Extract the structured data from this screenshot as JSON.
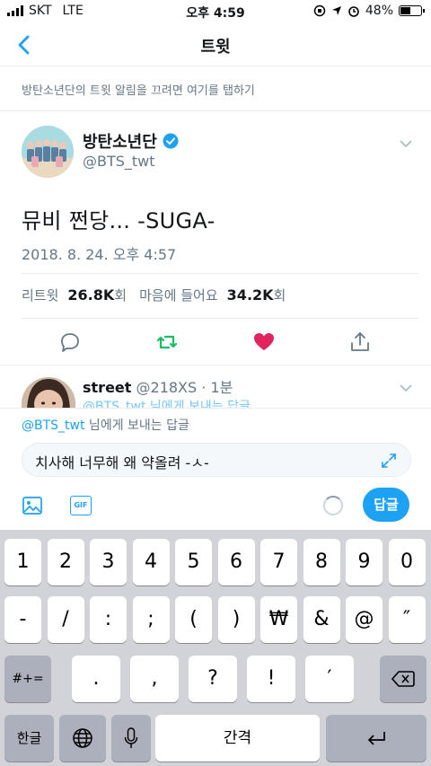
{
  "status": {
    "carrier": "SKT",
    "network": "LTE",
    "time": "오후 4:59",
    "battery": "48%",
    "battery_level": 0.48
  },
  "nav": {
    "title": "트윗"
  },
  "notice": {
    "text": "방탄소년단의 트윗 알림을 끄려면 여기를 탭하기"
  },
  "tweet": {
    "name": "방탄소년단",
    "handle": "@BTS_twt",
    "text": "뮤비 쩐당... -SUGA-",
    "date": "2018. 8. 24. 오후 4:57",
    "retweet_label": "리트윗",
    "retweet_count": "26.8K",
    "retweet_unit": "회",
    "likes_label": "마음에 들어요",
    "likes_count": "34.2K",
    "likes_unit": "회"
  },
  "reply": {
    "name": "street",
    "meta": "@218XS · 1분",
    "to_ghost": "@BTS_twt 님에게 보내는 답글"
  },
  "compose": {
    "reply_to_mention": "@BTS_twt",
    "reply_to_text": " 님에게 보내는 답글",
    "input_value": "치사해 너무해 왜 약올려 -ㅅ-",
    "gif_label": "GIF",
    "send_label": "답글"
  },
  "colors": {
    "accent": "#1da1f2",
    "retweet": "#17bf63",
    "like": "#e0245e"
  },
  "keyboard": {
    "row1": [
      "1",
      "2",
      "3",
      "4",
      "5",
      "6",
      "7",
      "8",
      "9",
      "0"
    ],
    "row2": [
      "-",
      "/",
      ":",
      ";",
      "(",
      ")",
      "₩",
      "&",
      "@",
      "″"
    ],
    "row3_left": "#+=",
    "row3": [
      ".",
      ",",
      "?",
      "!",
      "′"
    ],
    "row4_lang": "한글",
    "row4_space": "간격"
  }
}
